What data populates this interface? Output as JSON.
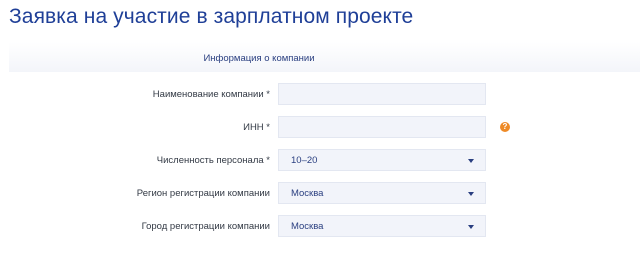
{
  "page": {
    "title": "Заявка на участие в зарплатном проекте"
  },
  "section": {
    "title": "Информация о компании"
  },
  "fields": [
    {
      "label": "Наименование компании *",
      "type": "text",
      "value": ""
    },
    {
      "label": "ИНН *",
      "type": "text",
      "value": "",
      "help_icon": "?"
    },
    {
      "label": "Численность персонала *",
      "type": "select",
      "value": "10–20"
    },
    {
      "label": "Регион регистрации компании",
      "type": "select",
      "value": "Москва"
    },
    {
      "label": "Город регистрации компании",
      "type": "select",
      "value": "Москва"
    }
  ],
  "colors": {
    "title": "#1f3f97",
    "field_bg": "#f2f4fa",
    "help_icon": "#ee8a27"
  },
  "icons": {
    "select_caret": "chevron-down-icon",
    "help": "help-icon"
  }
}
